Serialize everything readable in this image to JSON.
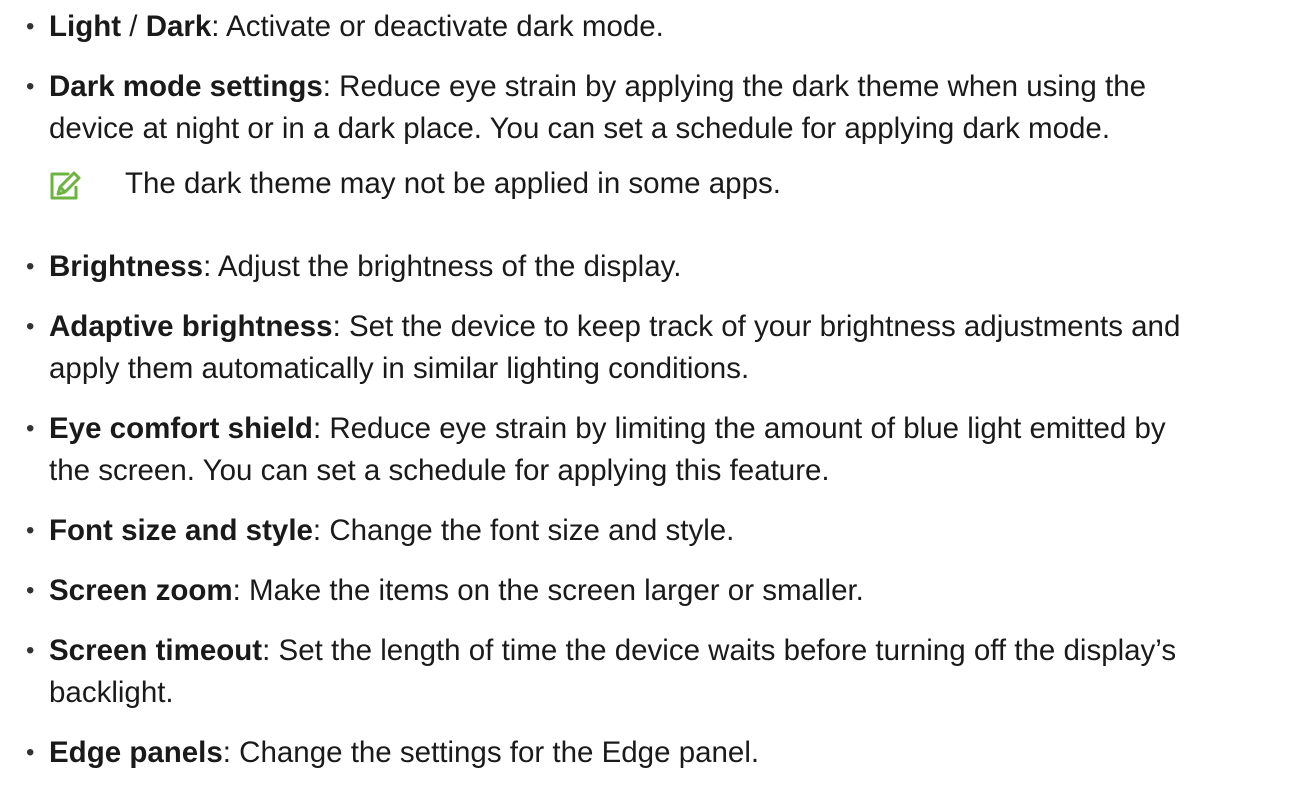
{
  "items": [
    {
      "term": "Light",
      "sep": " / ",
      "term2": "Dark",
      "desc": ": Activate or deactivate dark mode."
    },
    {
      "term": "Dark mode settings",
      "line1": ": Reduce eye strain by applying the dark theme when using the",
      "line2": "device at night or in a dark place. You can set a schedule for applying dark mode."
    },
    {
      "term": "Brightness",
      "desc": ": Adjust the brightness of the display."
    },
    {
      "term": "Adaptive brightness",
      "line1": ": Set the device to keep track of your brightness adjustments and",
      "line2": "apply them automatically in similar lighting conditions."
    },
    {
      "term": "Eye comfort shield",
      "line1": ": Reduce eye strain by limiting the amount of blue light emitted by",
      "line2": "the screen. You can set a schedule for applying this feature."
    },
    {
      "term": "Font size and style",
      "desc": ": Change the font size and style."
    },
    {
      "term": "Screen zoom",
      "desc": ": Make the items on the screen larger or smaller."
    },
    {
      "term": "Screen timeout",
      "line1": ": Set the length of time the device waits before turning off the display’s",
      "line2": "backlight."
    },
    {
      "term": "Edge panels",
      "desc": ": Change the settings for the Edge panel."
    }
  ],
  "note": {
    "icon": "note-pencil-icon",
    "text": "The dark theme may not be applied in some apps.",
    "icon_color": "#6cb33f"
  },
  "bullet_char": "•"
}
